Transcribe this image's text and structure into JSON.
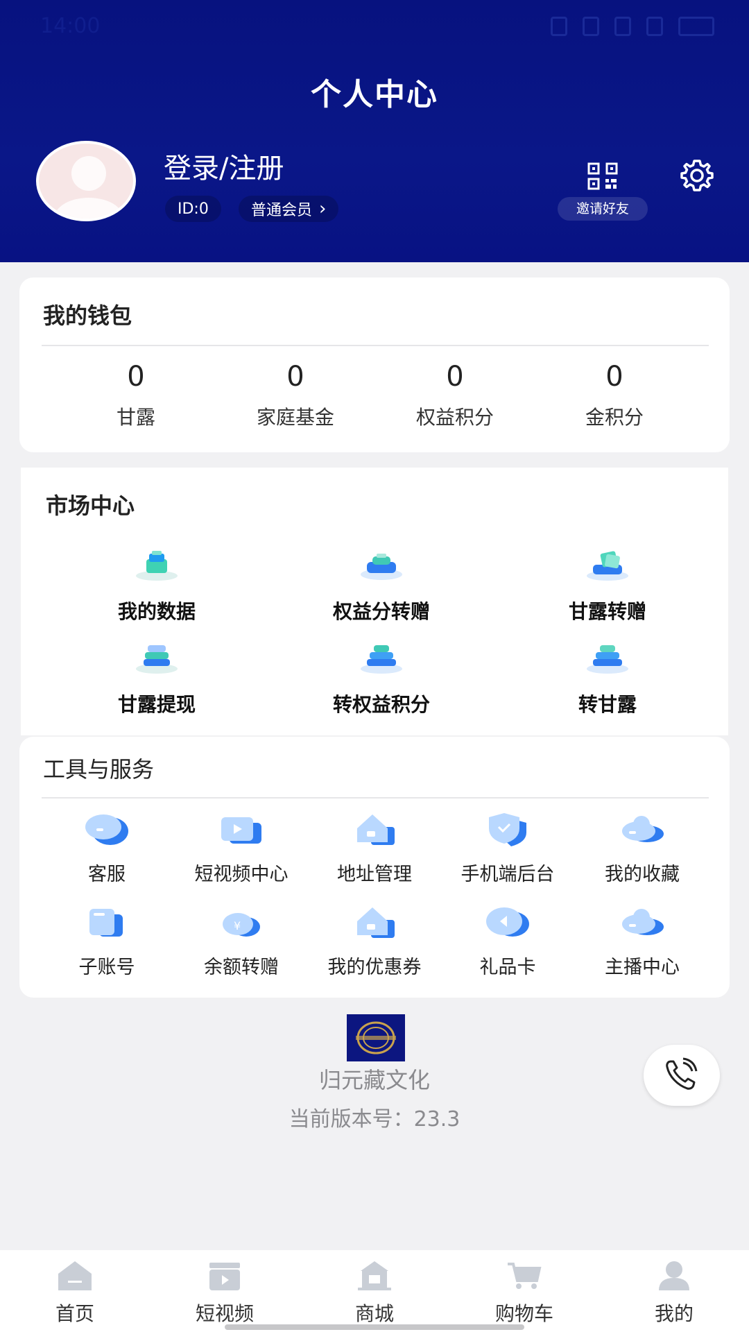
{
  "status": {
    "time": "14:00"
  },
  "header": {
    "title": "个人中心",
    "login_text": "登录/注册",
    "id_label": "ID:0",
    "member_label": "普通会员",
    "invite_label": "邀请好友"
  },
  "wallet": {
    "title": "我的钱包",
    "items": [
      {
        "value": "0",
        "label": "甘露"
      },
      {
        "value": "0",
        "label": "家庭基金"
      },
      {
        "value": "0",
        "label": "权益积分"
      },
      {
        "value": "0",
        "label": "金积分"
      }
    ]
  },
  "market": {
    "title": "市场中心",
    "items": [
      {
        "label": "我的数据"
      },
      {
        "label": "权益分转赠"
      },
      {
        "label": "甘露转赠"
      },
      {
        "label": "甘露提现"
      },
      {
        "label": "转权益积分"
      },
      {
        "label": "转甘露"
      }
    ]
  },
  "tools": {
    "title": "工具与服务",
    "items": [
      {
        "label": "客服"
      },
      {
        "label": "短视频中心"
      },
      {
        "label": "地址管理"
      },
      {
        "label": "手机端后台"
      },
      {
        "label": "我的收藏"
      },
      {
        "label": "子账号"
      },
      {
        "label": "余额转赠"
      },
      {
        "label": "我的优惠券"
      },
      {
        "label": "礼品卡"
      },
      {
        "label": "主播中心"
      }
    ]
  },
  "footer": {
    "brand": "归元藏文化",
    "version": "当前版本号：23.3"
  },
  "nav": {
    "items": [
      {
        "label": "首页"
      },
      {
        "label": "短视频"
      },
      {
        "label": "商城"
      },
      {
        "label": "购物车"
      },
      {
        "label": "我的"
      }
    ]
  },
  "colors": {
    "header_bg": "#07127f",
    "icon_blue": "#2f7cf0",
    "accent_light": "#9fc6ff"
  }
}
